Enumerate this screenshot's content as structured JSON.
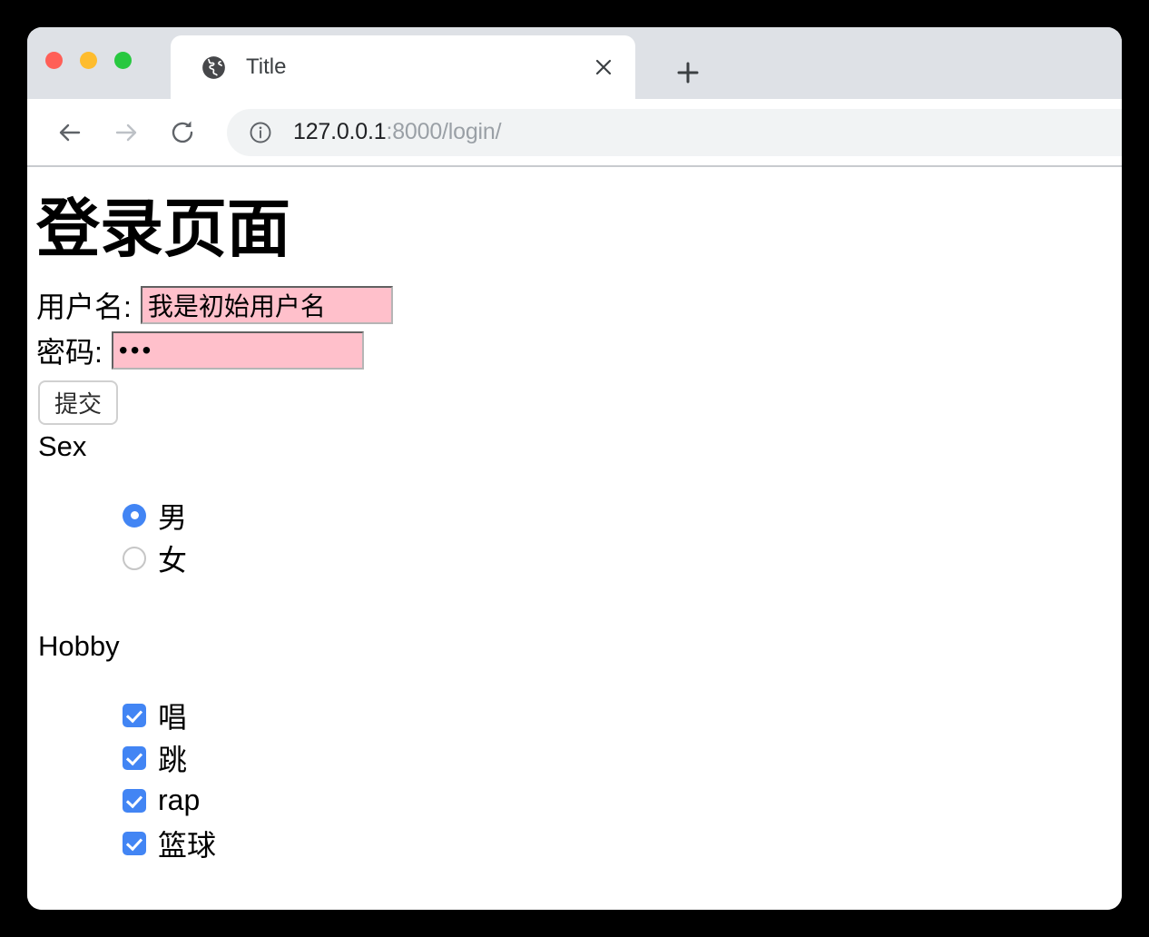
{
  "window": {
    "traffic_lights": [
      {
        "name": "close",
        "color": "#ff5f57"
      },
      {
        "name": "minimize",
        "color": "#febc2e"
      },
      {
        "name": "maximize",
        "color": "#28c840"
      }
    ]
  },
  "browser": {
    "tab": {
      "title": "Title",
      "favicon": "globe-icon",
      "close_label": "×"
    },
    "new_tab_label": "+",
    "nav": {
      "back": "back-arrow-icon",
      "forward": "forward-arrow-icon",
      "reload": "reload-icon"
    },
    "omnibox": {
      "security_icon": "info-circle-icon",
      "url_host": "127.0.0.1",
      "url_rest": ":8000/login/",
      "full_url": "127.0.0.1:8000/login/"
    }
  },
  "page": {
    "heading": "登录页面",
    "form": {
      "username_label": "用户名:",
      "username_value": "我是初始用户名",
      "password_label": "密码:",
      "password_value": "•••",
      "submit_label": "提交"
    },
    "sex": {
      "label": "Sex",
      "options": [
        {
          "label": "男",
          "checked": true
        },
        {
          "label": "女",
          "checked": false
        }
      ]
    },
    "hobby": {
      "label": "Hobby",
      "options": [
        {
          "label": "唱",
          "checked": true
        },
        {
          "label": "跳",
          "checked": true
        },
        {
          "label": "rap",
          "checked": true
        },
        {
          "label": "篮球",
          "checked": true
        }
      ]
    }
  },
  "colors": {
    "input_background": "#ffc0cb",
    "control_accent": "#4285f4",
    "tabstrip": "#dee1e6",
    "omnibox": "#f1f3f4"
  }
}
